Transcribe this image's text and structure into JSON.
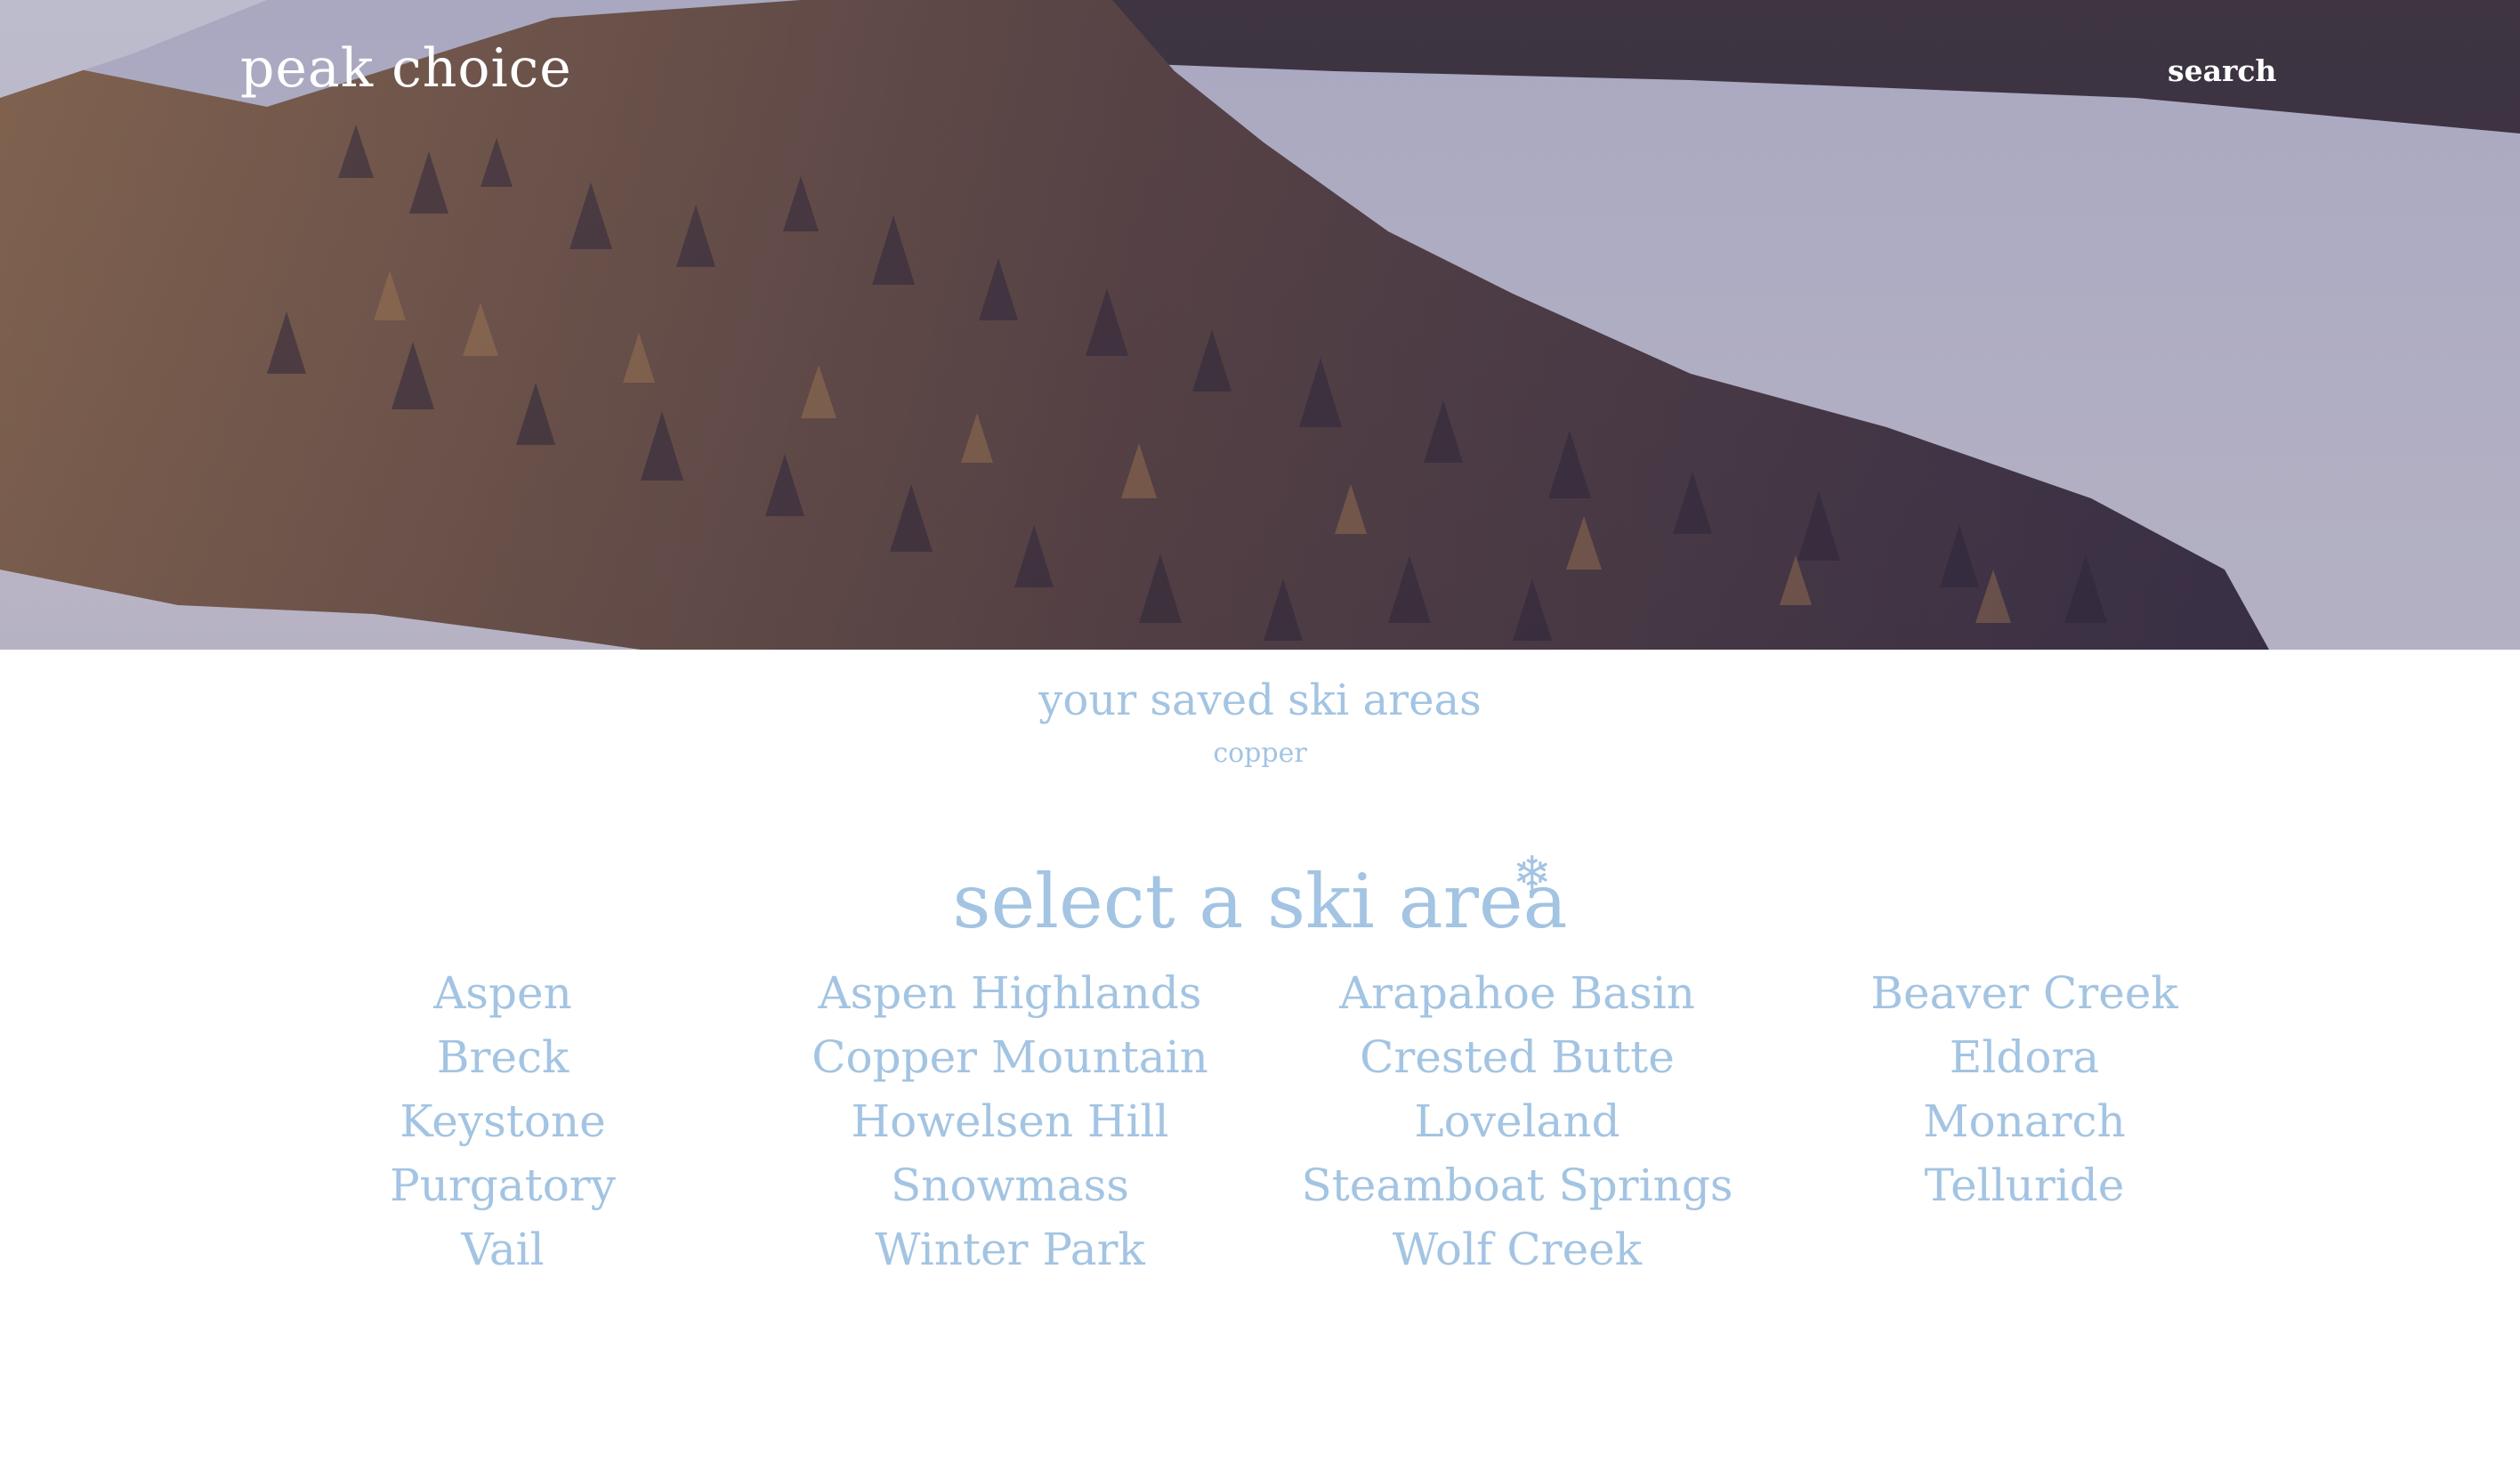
{
  "header": {
    "brand": "peak choice",
    "search_label": "search"
  },
  "saved": {
    "title": "your saved ski areas",
    "items": [
      "copper"
    ]
  },
  "select": {
    "heading": "select a ski area",
    "icon": "snowflake-icon"
  },
  "ski_areas": [
    "Aspen",
    "Aspen Highlands",
    "Arapahoe Basin",
    "Beaver Creek",
    "Breck",
    "Copper Mountain",
    "Crested Butte",
    "Eldora",
    "Keystone",
    "Howelsen Hill",
    "Loveland",
    "Monarch",
    "Purgatory",
    "Snowmass",
    "Steamboat Springs",
    "Telluride",
    "Vail",
    "Winter Park",
    "Wolf Creek"
  ],
  "colors": {
    "accent": "#a3c4e2",
    "header_text": "#ffffff"
  }
}
